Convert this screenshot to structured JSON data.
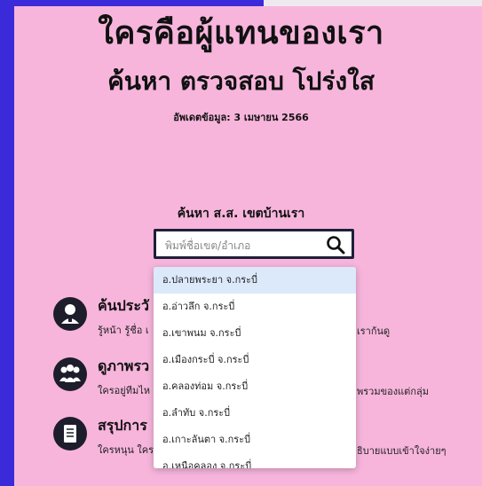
{
  "header": {
    "title": "ใครคือผู้แทนของเรา",
    "subtitle": "ค้นหา ตรวจสอบ โปร่งใส",
    "updated": "อัพเดตข้อมูล: 3 เมษายน 2566"
  },
  "search": {
    "label": "ค้นหา ส.ส. เขตบ้านเรา",
    "placeholder": "พิมพ์ชื่อเขต/อำเภอ",
    "value": ""
  },
  "features": [
    {
      "title": "ค้นประวั",
      "desc_left": "รู้หน้า รู้ชื่อ เ",
      "desc_right": "เราก้นดู",
      "icon": "person-icon"
    },
    {
      "title": "ดูภาพรว",
      "desc_left": "ใครอยู่ทีมไห",
      "desc_right": "พรวมของแต่กลุ่ม",
      "icon": "group-icon"
    },
    {
      "title": "สรุปการ",
      "desc_left": "ใครหนุน ใคร",
      "desc_right": "ธิบายแบบเข้าใจง่ายๆ",
      "icon": "document-icon"
    }
  ],
  "dropdown": {
    "items": [
      "อ.ปลายพระยา จ.กระบี่",
      "อ.อ่าวลึก จ.กระบี่",
      "อ.เขาพนม จ.กระบี่",
      "อ.เมืองกระบี่ จ.กระบี่",
      "อ.คลองท่อม จ.กระบี่",
      "อ.ลำทับ จ.กระบี่",
      "อ.เกาะลันตา จ.กระบี่",
      "อ.เหนือคลอง จ.กระบี่"
    ],
    "active_index": 0
  },
  "colors": {
    "background": "#f7b5dc",
    "accent": "#3b2ad9",
    "dark": "#1d1d2b",
    "highlight": "#dbe9fb"
  }
}
